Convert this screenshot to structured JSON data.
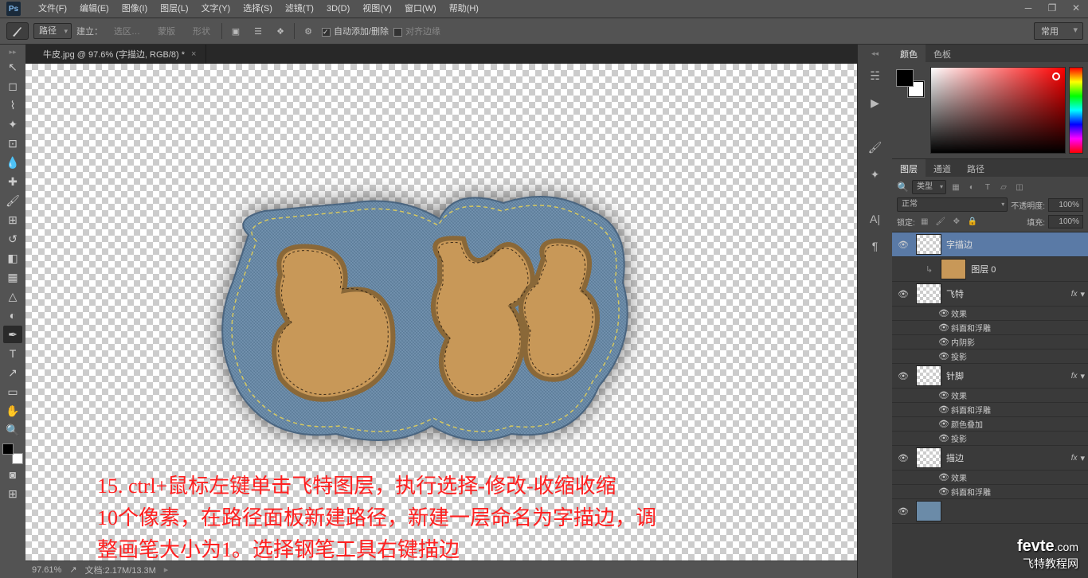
{
  "app": {
    "logo": "Ps"
  },
  "menu": [
    "文件(F)",
    "编辑(E)",
    "图像(I)",
    "图层(L)",
    "文字(Y)",
    "选择(S)",
    "滤镜(T)",
    "3D(D)",
    "视图(V)",
    "窗口(W)",
    "帮助(H)"
  ],
  "workspace_dd": "常用",
  "opt": {
    "mode": "路径",
    "build": "建立：",
    "sel": "选区…",
    "mask": "蒙版",
    "shape": "形状",
    "auto": "自动添加/删除",
    "align": "对齐边缘"
  },
  "doc": {
    "tab": "牛皮.jpg @ 97.6% (字描边, RGB/8) *"
  },
  "red_lines": [
    "15. ctrl+鼠标左键单击飞特图层，执行选择-修改-收缩收缩",
    "10个像素，在路径面板新建路径，新建一层命名为字描边，调",
    "整画笔大小为1。选择钢笔工具右键描边"
  ],
  "status": {
    "zoom": "97.61%",
    "doc": "文档:2.17M/13.3M"
  },
  "panel": {
    "color_tab": "颜色",
    "swatch_tab": "色板",
    "layers_tab": "图层",
    "channels_tab": "通道",
    "paths_tab": "路径",
    "kind": "类型",
    "blend": "正常",
    "opacity_lbl": "不透明度:",
    "opacity": "100%",
    "lock_lbl": "锁定:",
    "fill_lbl": "填充:",
    "fill": "100%"
  },
  "layers": {
    "l0": "字描边",
    "l1": "图层 0",
    "l2": "飞特",
    "l3": "针脚",
    "l4": "描边",
    "fx": "效果",
    "bevel": "斜面和浮雕",
    "inner": "内阴影",
    "drop": "投影",
    "overlay": "颜色叠加"
  },
  "watermark": {
    "brand": "fevte",
    "dom": ".com",
    "cn": "飞特教程网"
  }
}
